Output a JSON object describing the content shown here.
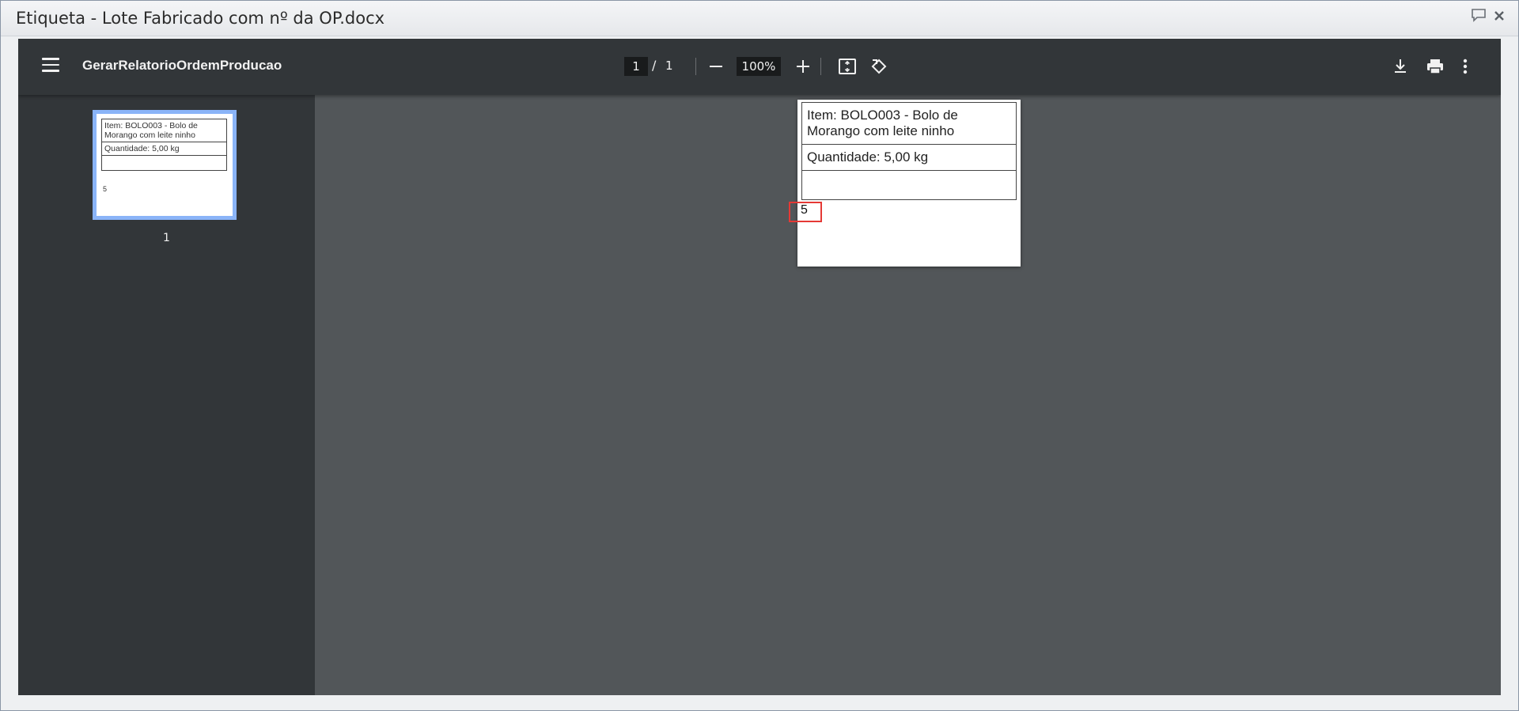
{
  "window": {
    "title": "Etiqueta - Lote Fabricado com nº da OP.docx",
    "icons": [
      "comment-icon",
      "close-icon"
    ]
  },
  "viewer": {
    "document_title": "GerarRelatorioOrdemProducao",
    "page": {
      "current": "1",
      "separator": "/",
      "total": "1"
    },
    "zoom": "100%",
    "toolbar_icons": [
      "menu-icon",
      "zoom-out-icon",
      "zoom-in-icon",
      "fit-page-icon",
      "rotate-icon",
      "download-icon",
      "print-icon",
      "more-options-icon"
    ]
  },
  "sidebar": {
    "thumbnails": [
      {
        "label": "1"
      }
    ]
  },
  "label_document": {
    "rows": [
      "Item: BOLO003 - Bolo de Morango com leite ninho",
      "Quantidade: 5,00 kg",
      ""
    ],
    "number": "5"
  },
  "colors": {
    "toolbar_bg": "#323639",
    "viewer_bg": "#525659",
    "thumbnail_selected": "#8ab4f8",
    "highlight_box": "#e53935"
  }
}
